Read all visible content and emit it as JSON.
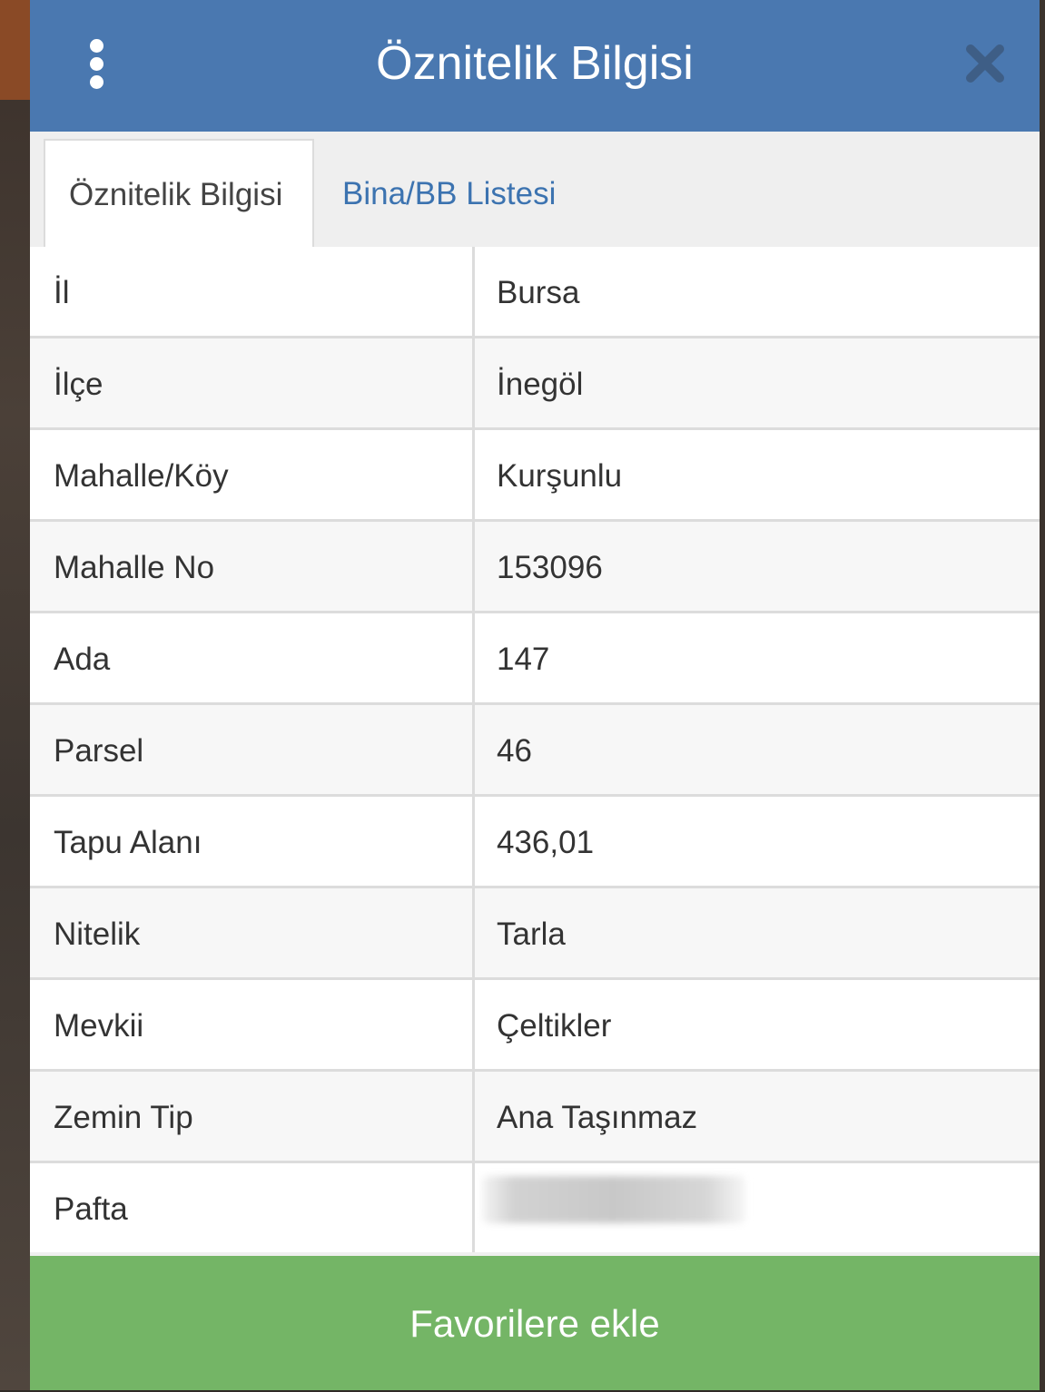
{
  "header": {
    "title": "Öznitelik Bilgisi",
    "menu_icon": "vertical-dots-icon",
    "close_icon": "close-x-icon",
    "color": "#4a78b0"
  },
  "tabs": [
    {
      "label": "Öznitelik Bilgisi",
      "active": true
    },
    {
      "label": "Bina/BB Listesi",
      "active": false
    }
  ],
  "attributes": [
    {
      "key": "İl",
      "value": "Bursa"
    },
    {
      "key": "İlçe",
      "value": "İnegöl"
    },
    {
      "key": "Mahalle/Köy",
      "value": "Kurşunlu"
    },
    {
      "key": "Mahalle No",
      "value": "153096"
    },
    {
      "key": "Ada",
      "value": "147"
    },
    {
      "key": "Parsel",
      "value": "46"
    },
    {
      "key": "Tapu Alanı",
      "value": "436,01"
    },
    {
      "key": "Nitelik",
      "value": "Tarla"
    },
    {
      "key": "Mevkii",
      "value": "Çeltikler"
    },
    {
      "key": "Zemin Tip",
      "value": "Ana Taşınmaz"
    },
    {
      "key": "Pafta",
      "value": ""
    }
  ],
  "footer": {
    "button_label": "Favorilere ekle",
    "color": "#74b566"
  }
}
